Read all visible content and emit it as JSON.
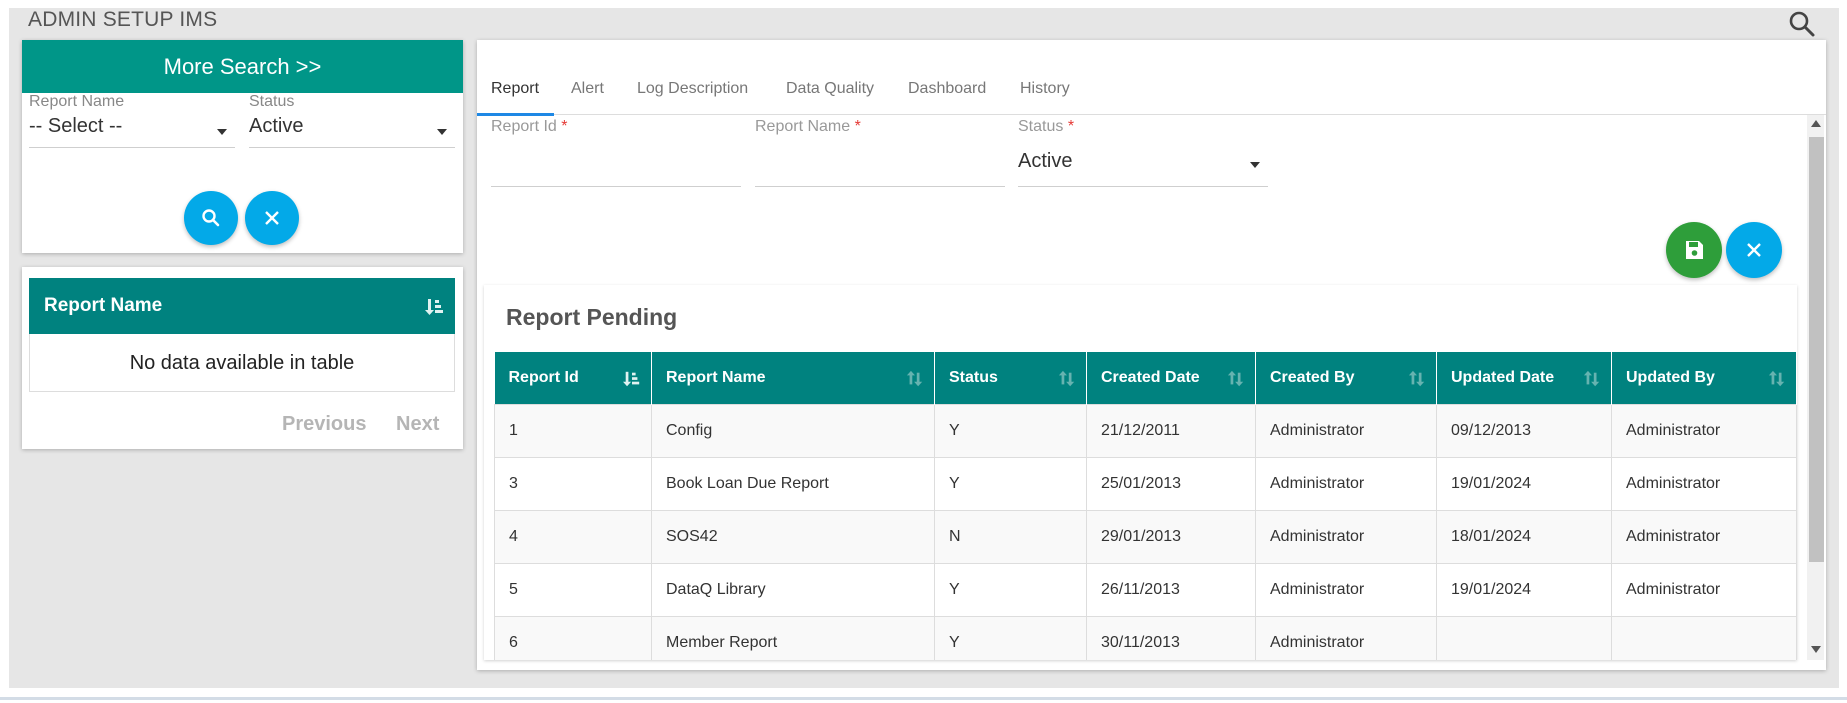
{
  "app": {
    "title": "ADMIN SETUP IMS"
  },
  "search_panel": {
    "more_search_label": "More Search >>",
    "report_name_label": "Report Name",
    "report_name_value": "-- Select --",
    "status_label": "Status",
    "status_value": "Active"
  },
  "report_list": {
    "header": "Report Name",
    "empty_message": "No data available in table",
    "previous_label": "Previous",
    "next_label": "Next"
  },
  "tabs": [
    {
      "label": "Report"
    },
    {
      "label": "Alert"
    },
    {
      "label": "Log Description"
    },
    {
      "label": "Data Quality"
    },
    {
      "label": "Dashboard"
    },
    {
      "label": "History"
    }
  ],
  "form": {
    "report_id_label": "Report Id",
    "report_name_label": "Report Name",
    "status_label": "Status",
    "status_value": "Active",
    "required_mark": "*"
  },
  "pending": {
    "title": "Report Pending",
    "columns": [
      "Report Id",
      "Report Name",
      "Status",
      "Created Date",
      "Created By",
      "Updated Date",
      "Updated By"
    ],
    "rows": [
      [
        "1",
        "Config",
        "Y",
        "21/12/2011",
        "Administrator",
        "09/12/2013",
        "Administrator"
      ],
      [
        "3",
        "Book Loan Due Report",
        "Y",
        "25/01/2013",
        "Administrator",
        "19/01/2024",
        "Administrator"
      ],
      [
        "4",
        "SOS42",
        "N",
        "29/01/2013",
        "Administrator",
        "18/01/2024",
        "Administrator"
      ],
      [
        "5",
        "DataQ Library",
        "Y",
        "26/11/2013",
        "Administrator",
        "19/01/2024",
        "Administrator"
      ],
      [
        "6",
        "Member Report",
        "Y",
        "30/11/2013",
        "Administrator",
        "",
        ""
      ]
    ]
  },
  "colors": {
    "teal_header": "#00827f",
    "more_search": "#009688",
    "round_button": "#03a9e8",
    "save_button": "#2e9e3a",
    "link": "#2a6fb6"
  }
}
